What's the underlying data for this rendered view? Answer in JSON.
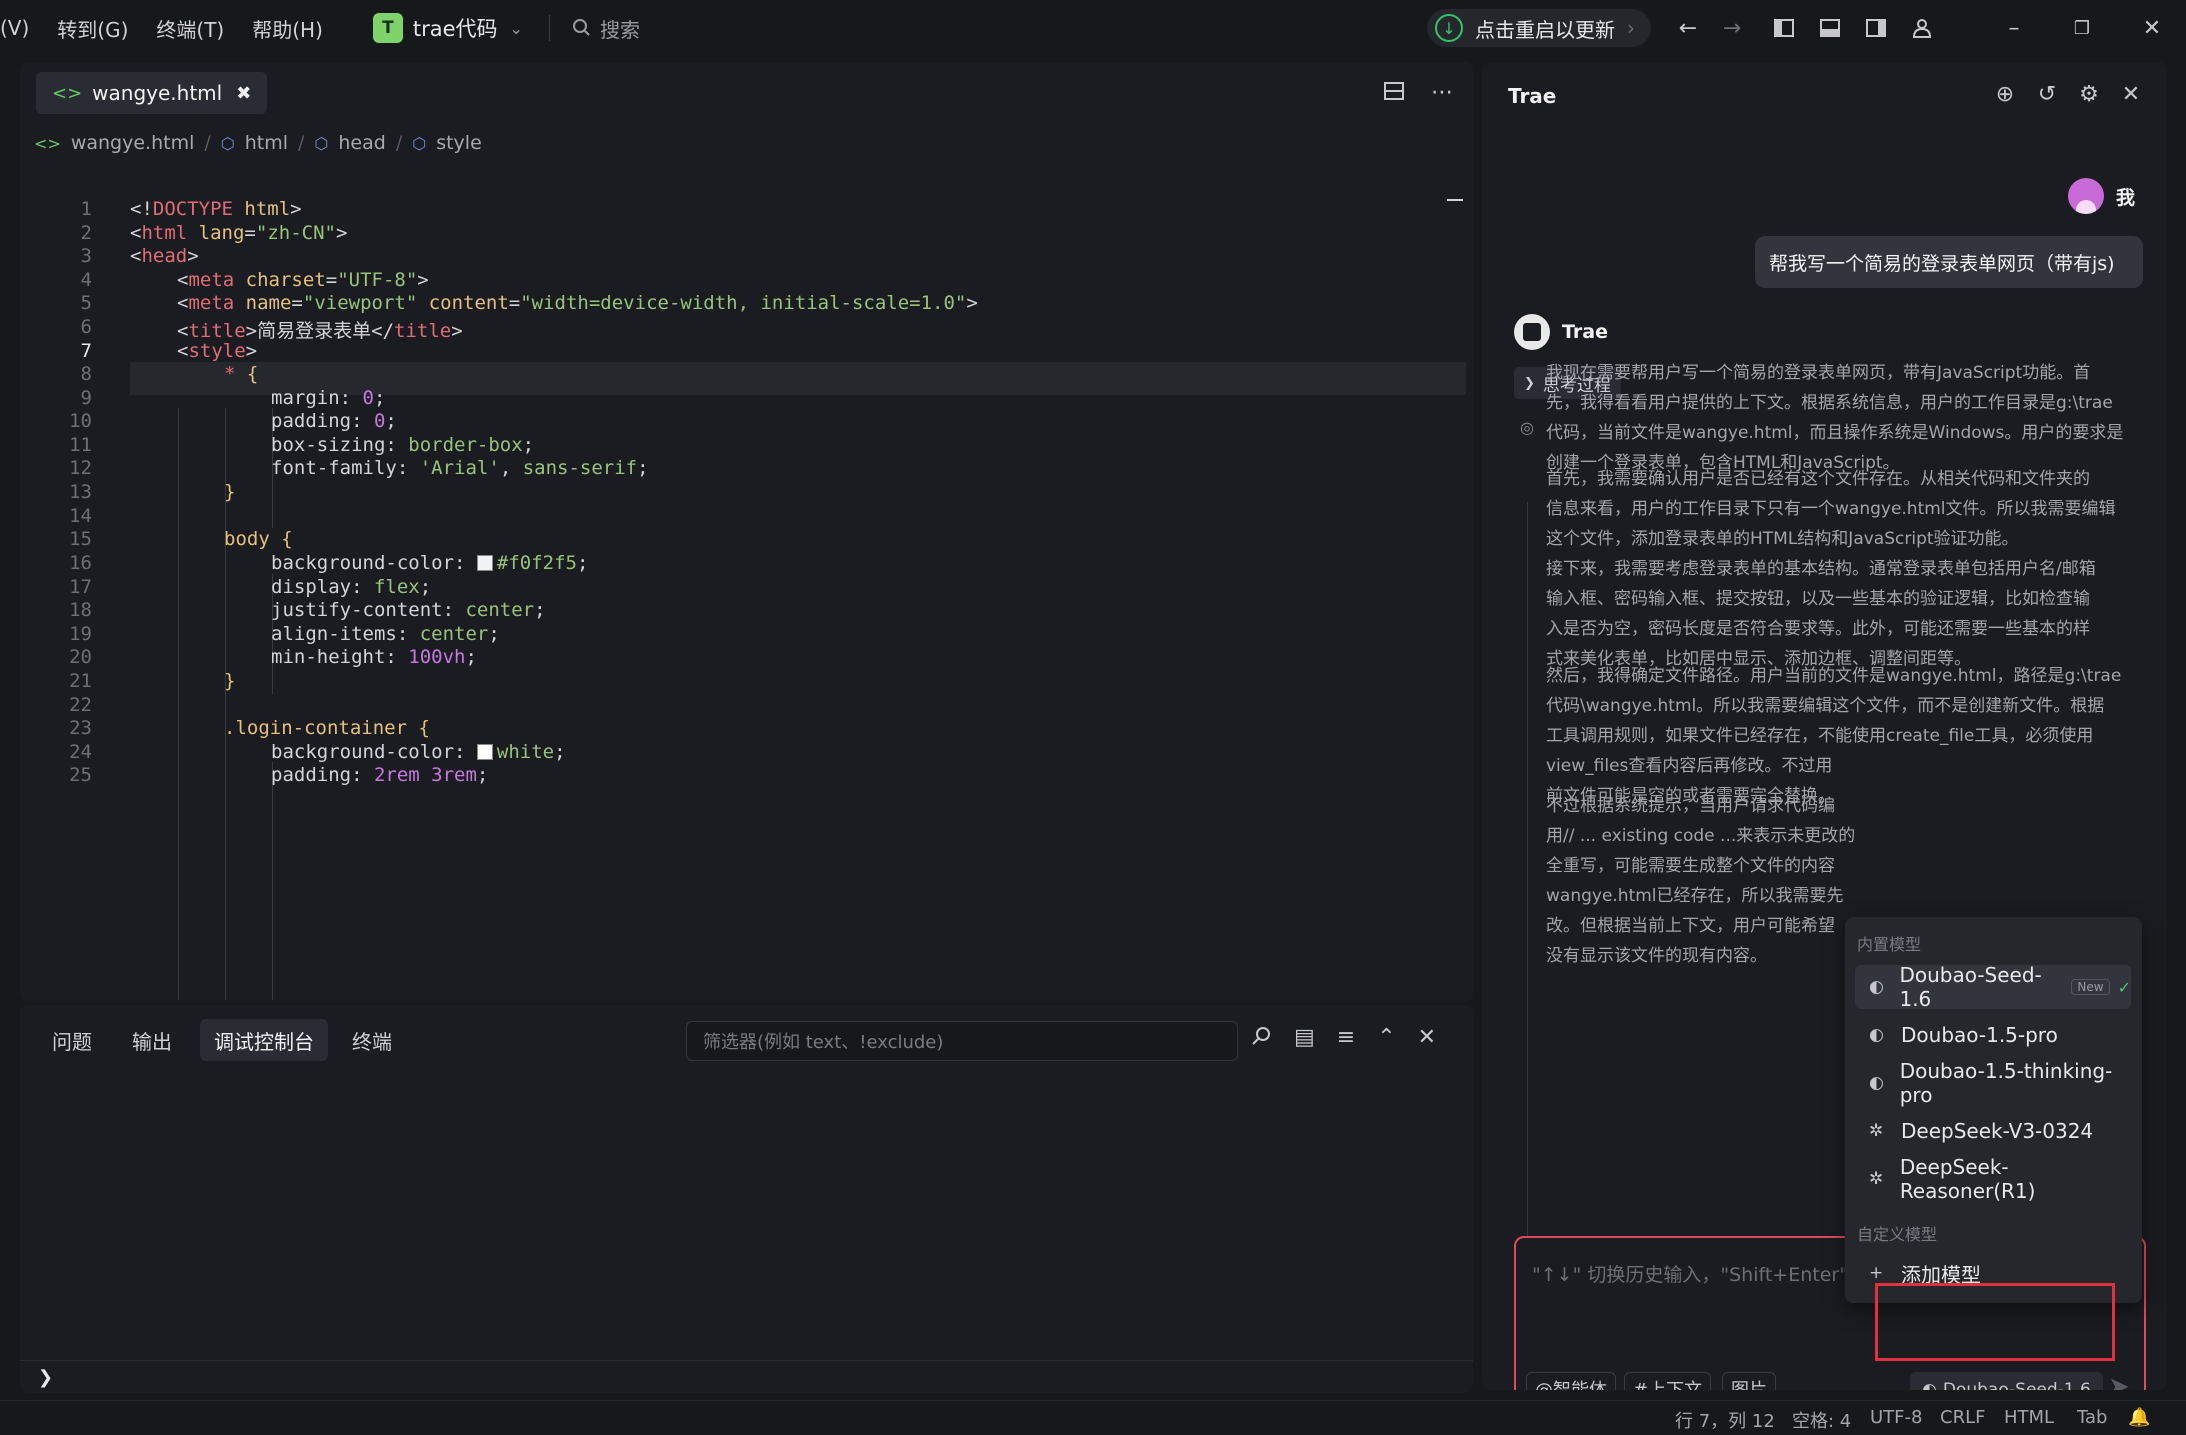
{
  "menu": [
    "(V)",
    "转到(G)",
    "终端(T)",
    "帮助(H)"
  ],
  "project": {
    "badge": "T",
    "name": "trae代码"
  },
  "search_label": "搜索",
  "update_label": "点击重启以更新",
  "editor": {
    "tab_label": "wangye.html",
    "breadcrumb": [
      "wangye.html",
      "html",
      "head",
      "style"
    ],
    "current_line": 7
  },
  "code_lines": [
    {
      "n": "1"
    },
    {
      "n": "2"
    },
    {
      "n": "3"
    },
    {
      "n": "4"
    },
    {
      "n": "5"
    },
    {
      "n": "6"
    },
    {
      "n": "7"
    },
    {
      "n": "8"
    },
    {
      "n": "9"
    },
    {
      "n": "10"
    },
    {
      "n": "11"
    },
    {
      "n": "12"
    },
    {
      "n": "13"
    },
    {
      "n": "14"
    },
    {
      "n": "15"
    },
    {
      "n": "16"
    },
    {
      "n": "17"
    },
    {
      "n": "18"
    },
    {
      "n": "19"
    },
    {
      "n": "20"
    },
    {
      "n": "21"
    },
    {
      "n": "22"
    },
    {
      "n": "23"
    },
    {
      "n": "24"
    },
    {
      "n": "25"
    }
  ],
  "code": {
    "l1a": "<!",
    "l1b": "DOCTYPE",
    "l1c": " html",
    "l1d": ">",
    "l2a": "<",
    "l2b": "html",
    "l2c": " lang",
    "l2d": "=",
    "l2e": "\"zh-CN\"",
    "l2f": ">",
    "l3a": "<",
    "l3b": "head",
    "l3c": ">",
    "l4a": "<",
    "l4b": "meta",
    "l4c": " charset",
    "l4d": "=",
    "l4e": "\"UTF-8\"",
    "l4f": ">",
    "l5a": "<",
    "l5b": "meta",
    "l5c": " name",
    "l5d": "=",
    "l5e": "\"viewport\"",
    "l5f": " content",
    "l5g": "=",
    "l5h": "\"width=device-width, initial-scale=1.0\"",
    "l5i": ">",
    "l6a": "<",
    "l6b": "title",
    "l6c": ">",
    "l6d": "简易登录表单",
    "l6e": "</",
    "l6f": "title",
    "l6g": ">",
    "l7a": "<",
    "l7b": "style",
    "l7c": ">",
    "l8a": "* ",
    "l8b": "{",
    "l9a": "margin",
    "l9b": ": ",
    "l9c": "0",
    "l9d": ";",
    "l10a": "padding",
    "l10b": ": ",
    "l10c": "0",
    "l10d": ";",
    "l11a": "box-sizing",
    "l11b": ": ",
    "l11c": "border-box",
    "l11d": ";",
    "l12a": "font-family",
    "l12b": ": ",
    "l12c": "'Arial'",
    "l12d": ", ",
    "l12e": "sans-serif",
    "l12f": ";",
    "l13": "}",
    "l15a": "body ",
    "l15b": "{",
    "l16a": "background-color",
    "l16b": ": ",
    "l16c": "#f0f2f5",
    "l16d": ";",
    "l17a": "display",
    "l17b": ": ",
    "l17c": "flex",
    "l17d": ";",
    "l18a": "justify-content",
    "l18b": ": ",
    "l18c": "center",
    "l18d": ";",
    "l19a": "align-items",
    "l19b": ": ",
    "l19c": "center",
    "l19d": ";",
    "l20a": "min-height",
    "l20b": ": ",
    "l20c": "100vh",
    "l20d": ";",
    "l21": "}",
    "l23a": ".login-container ",
    "l23b": "{",
    "l24a": "background-color",
    "l24b": ": ",
    "l24c": "white",
    "l24d": ";",
    "l25a": "padding",
    "l25b": ": ",
    "l25c": "2rem 3rem",
    "l25d": ";"
  },
  "colors": {
    "swatch1": "#f0f2f5",
    "swatch2": "#ffffff",
    "accent_red": "#e0313f",
    "check_green": "#4fc37a"
  },
  "panel": {
    "tabs": [
      "问题",
      "输出",
      "调试控制台",
      "终端"
    ],
    "active_tab": "调试控制台",
    "filter_placeholder": "筛选器(例如 text、!exclude)"
  },
  "chat": {
    "title": "Trae",
    "user_label": "我",
    "user_message": "帮我写一个简易的登录表单网页（带有js)",
    "assistant_label": "Trae",
    "think_label": "思考过程",
    "paragraphs": [
      [
        "我现在需要帮用户写一个简易的登录表单网页，带有JavaScript功能。首",
        "先，我得看看用户提供的上下文。根据系统信息，用户的工作目录是g:\\trae",
        "代码，当前文件是wangye.html，而且操作系统是Windows。用户的要求是",
        "创建一个登录表单，包含HTML和JavaScript。"
      ],
      [
        "首先，我需要确认用户是否已经有这个文件存在。从相关代码和文件夹的",
        "信息来看，用户的工作目录下只有一个wangye.html文件。所以我需要编辑",
        "这个文件，添加登录表单的HTML结构和JavaScript验证功能。"
      ],
      [
        "接下来，我需要考虑登录表单的基本结构。通常登录表单包括用户名/邮箱",
        "输入框、密码输入框、提交按钮，以及一些基本的验证逻辑，比如检查输",
        "入是否为空，密码长度是否符合要求等。此外，可能还需要一些基本的样",
        "式来美化表单，比如居中显示、添加边框、调整间距等。"
      ],
      [
        "然后，我得确定文件路径。用户当前的文件是wangye.html，路径是g:\\trae",
        "代码\\wangye.html。所以我需要编辑这个文件，而不是创建新文件。根据",
        "工具调用规则，如果文件已经存在，不能使用create_file工具，必须使用",
        "view_files查看内容后再修改。不过用",
        "前文件可能是空的或者需要完全替换。"
      ],
      [
        "不过根据系统提示，当用户请求代码编",
        "用// ... existing code ...来表示未更改的",
        "全重写，可能需要生成整个文件的内容",
        "wangye.html已经存在，所以我需要先",
        "改。但根据当前上下文，用户可能希望",
        "没有显示该文件的现有内容。"
      ]
    ],
    "input_placeholder": "\"↑↓\" 切换历史输入，\"Shift+Enter\" 换行",
    "chips": [
      "@智能体",
      "#上下文",
      "图片"
    ],
    "model_chip": "Doubao-Seed-1.6"
  },
  "model_menu": {
    "builtin_label": "内置模型",
    "builtin": [
      {
        "label": "Doubao-Seed-1.6",
        "icon": "doubao-icon",
        "badge": "New",
        "selected": true
      },
      {
        "label": "Doubao-1.5-pro",
        "icon": "doubao-icon"
      },
      {
        "label": "Doubao-1.5-thinking-pro",
        "icon": "doubao-icon"
      },
      {
        "label": "DeepSeek-V3-0324",
        "icon": "deepseek-icon"
      },
      {
        "label": "DeepSeek-Reasoner(R1)",
        "icon": "deepseek-icon"
      }
    ],
    "custom_label": "自定义模型",
    "add_label": "添加模型"
  },
  "status": {
    "position": "行 7，列 12",
    "spaces": "空格: 4",
    "encoding": "UTF-8",
    "eol": "CRLF",
    "language": "HTML",
    "indent": "Tab"
  }
}
